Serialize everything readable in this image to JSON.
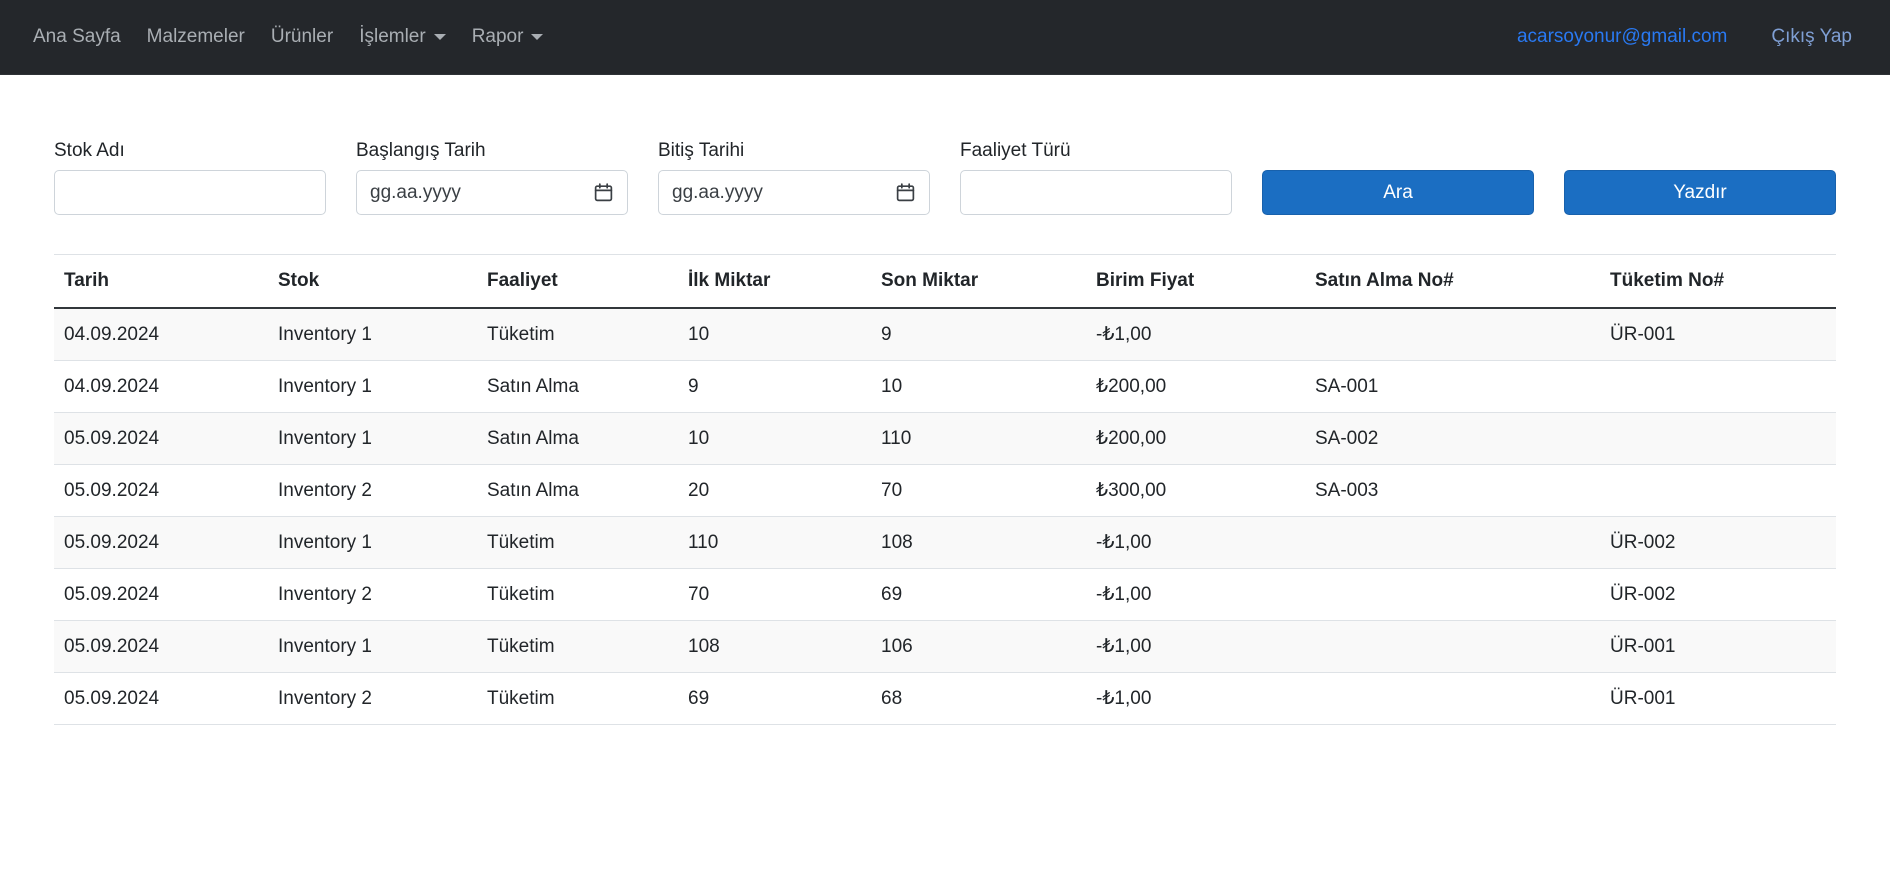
{
  "navbar": {
    "items": [
      {
        "name": "nav-item-ana-sayfa",
        "label": "Ana Sayfa",
        "dropdown": false
      },
      {
        "name": "nav-item-malzemeler",
        "label": "Malzemeler",
        "dropdown": false
      },
      {
        "name": "nav-item-urunler",
        "label": "Ürünler",
        "dropdown": false
      },
      {
        "name": "nav-item-islemler",
        "label": "İşlemler",
        "dropdown": true
      },
      {
        "name": "nav-item-rapor",
        "label": "Rapor",
        "dropdown": true
      }
    ],
    "email": "acarsoyonur@gmail.com",
    "logout_label": "Çıkış Yap"
  },
  "filters": {
    "stock_name": {
      "label": "Stok Adı",
      "value": "",
      "placeholder": ""
    },
    "start_date": {
      "label": "Başlangış Tarih",
      "placeholder": "gg.aa.yyyy"
    },
    "end_date": {
      "label": "Bitiş Tarihi",
      "placeholder": "gg.aa.yyyy"
    },
    "activity_type": {
      "label": "Faaliyet Türü",
      "value": "",
      "placeholder": ""
    },
    "search_button_label": "Ara",
    "print_button_label": "Yazdır"
  },
  "table": {
    "headers": [
      "Tarih",
      "Stok",
      "Faaliyet",
      "İlk Miktar",
      "Son Miktar",
      "Birim Fiyat",
      "Satın Alma No#",
      "Tüketim No#"
    ],
    "rows": [
      [
        "04.09.2024",
        "Inventory 1",
        "Tüketim",
        "10",
        "9",
        "-₺1,00",
        "",
        "ÜR-001"
      ],
      [
        "04.09.2024",
        "Inventory 1",
        "Satın Alma",
        "9",
        "10",
        "₺200,00",
        "SA-001",
        ""
      ],
      [
        "05.09.2024",
        "Inventory 1",
        "Satın Alma",
        "10",
        "110",
        "₺200,00",
        "SA-002",
        ""
      ],
      [
        "05.09.2024",
        "Inventory 2",
        "Satın Alma",
        "20",
        "70",
        "₺300,00",
        "SA-003",
        ""
      ],
      [
        "05.09.2024",
        "Inventory 1",
        "Tüketim",
        "110",
        "108",
        "-₺1,00",
        "",
        "ÜR-002"
      ],
      [
        "05.09.2024",
        "Inventory 2",
        "Tüketim",
        "70",
        "69",
        "-₺1,00",
        "",
        "ÜR-002"
      ],
      [
        "05.09.2024",
        "Inventory 1",
        "Tüketim",
        "108",
        "106",
        "-₺1,00",
        "",
        "ÜR-001"
      ],
      [
        "05.09.2024",
        "Inventory 2",
        "Tüketim",
        "69",
        "68",
        "-₺1,00",
        "",
        "ÜR-001"
      ]
    ]
  },
  "colors": {
    "navbar_bg": "#24272b",
    "primary_button": "#1b6ec2",
    "email_link": "#2979f2",
    "logout_link": "#7f9fd4",
    "table_border": "#dee2e6"
  }
}
